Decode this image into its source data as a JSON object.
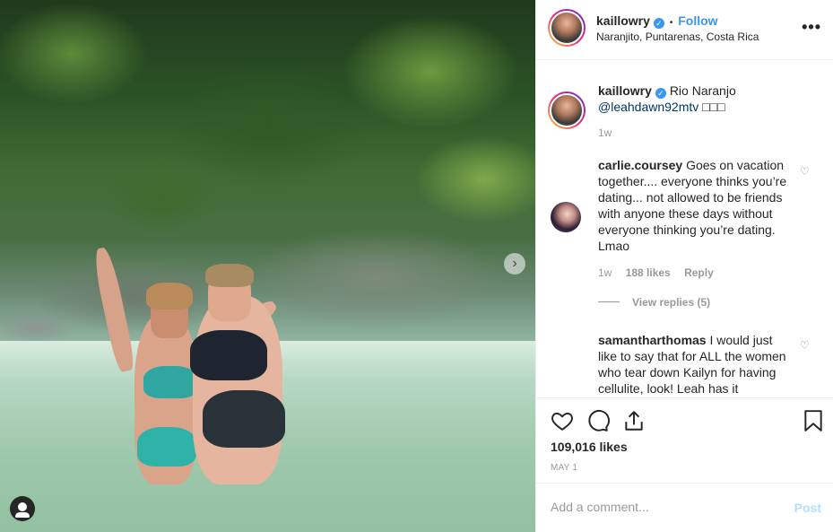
{
  "post": {
    "image_alt": "Two women standing in a river in front of a jungle waterfall",
    "next_icon": "chevron-right-icon",
    "tag_icon": "user-tag-icon"
  },
  "header": {
    "username": "kaillowry",
    "separator": "•",
    "follow_label": "Follow",
    "location": "Naranjito, Puntarenas, Costa Rica",
    "more_label": "•••"
  },
  "caption": {
    "username": "kaillowry",
    "text": "Rio Naranjo",
    "mention": "@leahdawn92mtv",
    "emoji_placeholder": "□□□",
    "time": "1w"
  },
  "comments": [
    {
      "username": "carlie.coursey",
      "text": "Goes on vacation together.... everyone thinks you’re dating... not allowed to be friends with anyone these days without everyone thinking you’re dating. Lmao",
      "time": "1w",
      "likes": "188 likes",
      "reply": "Reply",
      "view_replies": "View replies (5)"
    },
    {
      "username": "samantharthomas",
      "text": "I would just like to say that for ALL the women who tear down Kailyn for having cellulite, look! Leah has it"
    }
  ],
  "actions": {
    "likes": "109,016 likes",
    "date": "MAY 1"
  },
  "add_comment": {
    "placeholder": "Add a comment...",
    "post_label": "Post"
  },
  "colors": {
    "accent": "#3897f0",
    "post_disabled": "#b2dffc",
    "muted": "#999999"
  }
}
